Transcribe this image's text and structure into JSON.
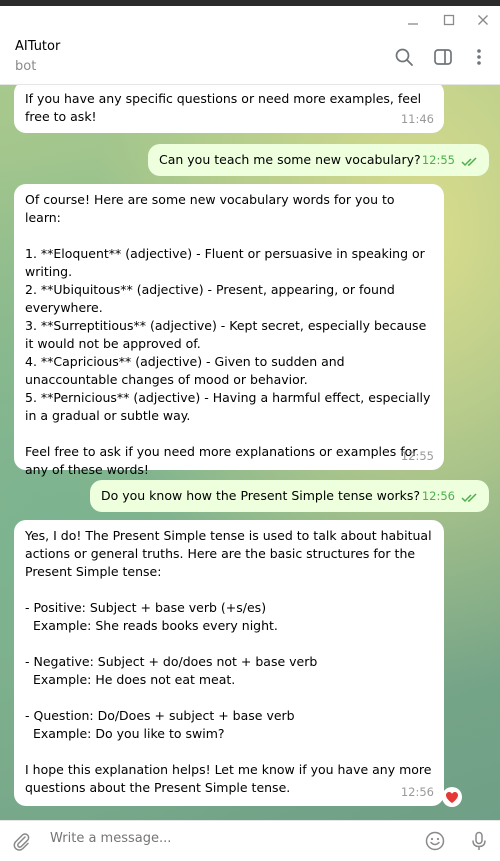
{
  "window": {
    "title": ""
  },
  "header": {
    "title": "AITutor",
    "subtitle": "bot"
  },
  "messages": [
    {
      "id": "m1",
      "direction": "in",
      "text": "If you have any specific questions or need more examples, feel free to ask!",
      "time": "11:46"
    },
    {
      "id": "m2",
      "direction": "out",
      "text": "Can you teach me some new vocabulary?",
      "time": "12:55"
    },
    {
      "id": "m3",
      "direction": "in",
      "text": "Of course! Here are some new vocabulary words for you to learn:\n\n1. **Eloquent** (adjective) - Fluent or persuasive in speaking or writing.\n2. **Ubiquitous** (adjective) - Present, appearing, or found everywhere.\n3. **Surreptitious** (adjective) - Kept secret, especially because it would not be approved of.\n4. **Capricious** (adjective) - Given to sudden and unaccountable changes of mood or behavior.\n5. **Pernicious** (adjective) - Having a harmful effect, especially in a gradual or subtle way.\n\nFeel free to ask if you need more explanations or examples for any of these words!",
      "time": "12:55"
    },
    {
      "id": "m4",
      "direction": "out",
      "text": "Do you know how the Present Simple tense works?",
      "time": "12:56"
    },
    {
      "id": "m5",
      "direction": "in",
      "text": "Yes, I do! The Present Simple tense is used to talk about habitual actions or general truths. Here are the basic structures for the Present Simple tense:\n\n- Positive: Subject + base verb (+s/es)\n  Example: She reads books every night.\n\n- Negative: Subject + do/does not + base verb\n  Example: He does not eat meat.\n\n- Question: Do/Does + subject + base verb\n  Example: Do you like to swim?\n\nI hope this explanation helps! Let me know if you have any more questions about the Present Simple tense.",
      "time": "12:56",
      "reaction": "heart"
    }
  ],
  "composer": {
    "placeholder": "Write a message..."
  },
  "colors": {
    "incoming_bubble": "#ffffff",
    "outgoing_bubble": "#eeffde",
    "read_ticks": "#4fae4e"
  },
  "icons": [
    "minimize-icon",
    "maximize-icon",
    "close-icon",
    "search-icon",
    "sidebar-toggle-icon",
    "more-vertical-icon",
    "attach-icon",
    "emoji-icon",
    "microphone-icon",
    "double-check-icon",
    "heart-icon"
  ]
}
